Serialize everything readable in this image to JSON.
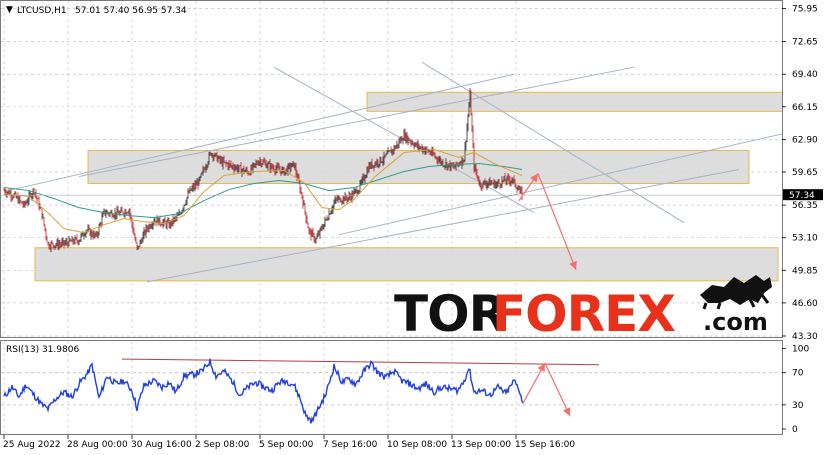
{
  "header": {
    "symbol": "LTCUSD,H1",
    "ohlc": "57.01 57.40 56.95 57.34"
  },
  "current_price_tag": "57.34",
  "brand": {
    "part1": "TOR",
    "part2": "FOREX",
    "suffix": ".com",
    "colors": {
      "dark": "#111111",
      "accent": "#e8311a"
    }
  },
  "chart_data": [
    {
      "type": "candlestick",
      "title": "LTCUSD,H1",
      "ylim": [
        43.3,
        76.5
      ],
      "yticks": [
        "75.95",
        "72.65",
        "69.40",
        "66.15",
        "62.90",
        "59.65",
        "56.35",
        "53.10",
        "49.85",
        "46.60",
        "43.30"
      ],
      "yticks_values": [
        75.95,
        72.65,
        69.4,
        66.15,
        62.9,
        59.65,
        56.35,
        53.1,
        49.85,
        46.6,
        43.3
      ],
      "xticks": [
        "25 Aug 2022",
        "28 Aug 00:00",
        "30 Aug 16:00",
        "2 Sep 08:00",
        "5 Sep 00:00",
        "7 Sep 16:00",
        "10 Sep 08:00",
        "13 Sep 00:00",
        "15 Sep 16:00"
      ],
      "xticks_bar_index": [
        0,
        64,
        128,
        192,
        256,
        320,
        384,
        448,
        512
      ],
      "price_path": [
        [
          0,
          57.8
        ],
        [
          10,
          57.3
        ],
        [
          20,
          56.3
        ],
        [
          30,
          57.9
        ],
        [
          38,
          55.4
        ],
        [
          44,
          52.4
        ],
        [
          60,
          52.5
        ],
        [
          75,
          52.9
        ],
        [
          82,
          53.9
        ],
        [
          92,
          53.2
        ],
        [
          100,
          55.6
        ],
        [
          115,
          55.5
        ],
        [
          125,
          55.9
        ],
        [
          133,
          51.9
        ],
        [
          142,
          53.9
        ],
        [
          150,
          54.9
        ],
        [
          165,
          54.4
        ],
        [
          175,
          55.3
        ],
        [
          185,
          57.6
        ],
        [
          195,
          58.7
        ],
        [
          207,
          61.6
        ],
        [
          218,
          60.6
        ],
        [
          232,
          60.1
        ],
        [
          245,
          59.6
        ],
        [
          255,
          60.8
        ],
        [
          268,
          60.1
        ],
        [
          280,
          59.7
        ],
        [
          290,
          60.4
        ],
        [
          298,
          57.2
        ],
        [
          305,
          53.7
        ],
        [
          312,
          52.9
        ],
        [
          322,
          54.9
        ],
        [
          332,
          56.9
        ],
        [
          345,
          57.1
        ],
        [
          355,
          58.0
        ],
        [
          365,
          60.2
        ],
        [
          380,
          61.0
        ],
        [
          392,
          62.2
        ],
        [
          400,
          63.3
        ],
        [
          412,
          62.3
        ],
        [
          425,
          61.7
        ],
        [
          438,
          60.6
        ],
        [
          450,
          60.1
        ],
        [
          460,
          61.0
        ],
        [
          466,
          67.3
        ],
        [
          470,
          60.2
        ],
        [
          476,
          58.4
        ],
        [
          484,
          58.6
        ],
        [
          492,
          58.4
        ],
        [
          500,
          58.8
        ],
        [
          508,
          58.9
        ],
        [
          514,
          58.0
        ],
        [
          518,
          57.34
        ]
      ],
      "ma_fast_path": [
        [
          0,
          57.5
        ],
        [
          25,
          57.2
        ],
        [
          45,
          55.5
        ],
        [
          60,
          54.0
        ],
        [
          80,
          53.6
        ],
        [
          100,
          54.4
        ],
        [
          120,
          55.0
        ],
        [
          140,
          54.7
        ],
        [
          160,
          54.5
        ],
        [
          180,
          55.3
        ],
        [
          200,
          57.7
        ],
        [
          220,
          59.3
        ],
        [
          250,
          59.7
        ],
        [
          280,
          59.8
        ],
        [
          300,
          58.6
        ],
        [
          318,
          56.1
        ],
        [
          335,
          55.9
        ],
        [
          350,
          56.9
        ],
        [
          370,
          59.1
        ],
        [
          400,
          61.6
        ],
        [
          430,
          61.9
        ],
        [
          455,
          61.1
        ],
        [
          470,
          61.6
        ],
        [
          490,
          60.5
        ],
        [
          518,
          59.3
        ]
      ],
      "ma_slow_path": [
        [
          0,
          58.1
        ],
        [
          25,
          57.8
        ],
        [
          50,
          57.0
        ],
        [
          75,
          56.1
        ],
        [
          100,
          55.6
        ],
        [
          125,
          55.3
        ],
        [
          150,
          55.1
        ],
        [
          175,
          55.5
        ],
        [
          200,
          56.8
        ],
        [
          225,
          57.9
        ],
        [
          250,
          58.5
        ],
        [
          275,
          58.8
        ],
        [
          300,
          58.5
        ],
        [
          325,
          57.8
        ],
        [
          350,
          58.1
        ],
        [
          375,
          58.9
        ],
        [
          400,
          59.7
        ],
        [
          425,
          60.2
        ],
        [
          450,
          60.4
        ],
        [
          475,
          60.5
        ],
        [
          500,
          60.2
        ],
        [
          518,
          59.9
        ]
      ],
      "zones": [
        {
          "bar_from": 363,
          "bar_to": 782,
          "y_high": 67.6,
          "y_low": 65.7
        },
        {
          "bar_from": 84,
          "bar_to": 745,
          "y_high": 61.8,
          "y_low": 58.5
        },
        {
          "bar_from": 31,
          "bar_to": 774,
          "y_high": 52.1,
          "y_low": 48.8
        }
      ],
      "trendlines": [
        {
          "from": [
            0,
            57.7
          ],
          "to": [
            510,
            69.4
          ]
        },
        {
          "from": [
            75,
            59.2
          ],
          "to": [
            630,
            70.1
          ]
        },
        {
          "from": [
            143,
            48.7
          ],
          "to": [
            735,
            59.9
          ]
        },
        {
          "from": [
            335,
            53.4
          ],
          "to": [
            785,
            63.6
          ]
        },
        {
          "from": [
            270,
            70.1
          ],
          "to": [
            530,
            55.6
          ]
        },
        {
          "from": [
            418,
            70.6
          ],
          "to": [
            680,
            54.6
          ]
        }
      ],
      "forecast_arrows": [
        {
          "from": [
            515,
            56.8
          ],
          "to": [
            534,
            59.5
          ]
        },
        {
          "from": [
            534,
            59.5
          ],
          "to": [
            572,
            49.9
          ]
        }
      ]
    },
    {
      "type": "line",
      "title": "RSI(13) 31.9806",
      "ylim": [
        -5,
        107
      ],
      "yticks": [
        "100",
        "70",
        "30",
        "0"
      ],
      "yticks_values": [
        100,
        70,
        30,
        0
      ],
      "levels": [
        70,
        30
      ],
      "rsi_path": [
        [
          0,
          40
        ],
        [
          8,
          52
        ],
        [
          15,
          40
        ],
        [
          22,
          55
        ],
        [
          30,
          42
        ],
        [
          38,
          30
        ],
        [
          44,
          25
        ],
        [
          52,
          38
        ],
        [
          60,
          46
        ],
        [
          68,
          40
        ],
        [
          76,
          58
        ],
        [
          84,
          70
        ],
        [
          88,
          80
        ],
        [
          95,
          38
        ],
        [
          103,
          66
        ],
        [
          112,
          56
        ],
        [
          120,
          60
        ],
        [
          128,
          48
        ],
        [
          133,
          26
        ],
        [
          140,
          54
        ],
        [
          150,
          60
        ],
        [
          158,
          52
        ],
        [
          165,
          58
        ],
        [
          172,
          46
        ],
        [
          180,
          66
        ],
        [
          190,
          68
        ],
        [
          198,
          72
        ],
        [
          206,
          84
        ],
        [
          212,
          66
        ],
        [
          220,
          72
        ],
        [
          228,
          60
        ],
        [
          236,
          42
        ],
        [
          244,
          52
        ],
        [
          252,
          58
        ],
        [
          260,
          52
        ],
        [
          268,
          48
        ],
        [
          275,
          58
        ],
        [
          282,
          60
        ],
        [
          290,
          55
        ],
        [
          296,
          38
        ],
        [
          302,
          16
        ],
        [
          308,
          10
        ],
        [
          314,
          24
        ],
        [
          322,
          44
        ],
        [
          330,
          78
        ],
        [
          338,
          58
        ],
        [
          345,
          62
        ],
        [
          352,
          56
        ],
        [
          360,
          72
        ],
        [
          367,
          82
        ],
        [
          374,
          70
        ],
        [
          382,
          64
        ],
        [
          390,
          72
        ],
        [
          398,
          60
        ],
        [
          406,
          56
        ],
        [
          414,
          50
        ],
        [
          422,
          56
        ],
        [
          430,
          46
        ],
        [
          438,
          52
        ],
        [
          446,
          50
        ],
        [
          454,
          48
        ],
        [
          460,
          60
        ],
        [
          465,
          76
        ],
        [
          470,
          46
        ],
        [
          478,
          48
        ],
        [
          486,
          42
        ],
        [
          494,
          52
        ],
        [
          502,
          44
        ],
        [
          510,
          60
        ],
        [
          515,
          50
        ],
        [
          519,
          32
        ]
      ],
      "resistance_line": {
        "from": [
          118,
          87
        ],
        "to": [
          595,
          80
        ]
      },
      "forecast_arrows": [
        {
          "from": [
            519,
            32
          ],
          "to": [
            541,
            82
          ]
        },
        {
          "from": [
            541,
            82
          ],
          "to": [
            566,
            16
          ]
        }
      ]
    }
  ]
}
